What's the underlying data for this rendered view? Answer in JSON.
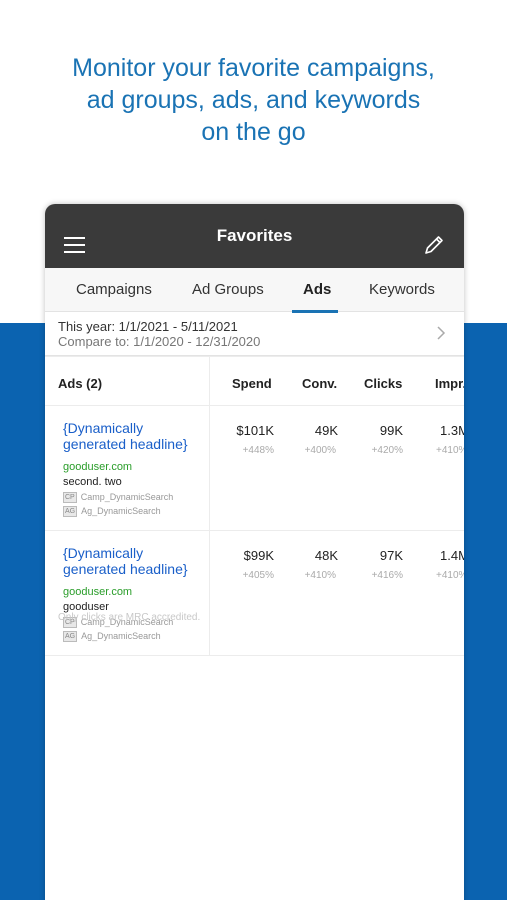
{
  "headline": {
    "line1": "Monitor your favorite campaigns,",
    "line2": "ad groups, ads, and keywords",
    "line3": "on the go"
  },
  "app": {
    "title": "Favorites",
    "tabs": [
      "Campaigns",
      "Ad Groups",
      "Ads",
      "Keywords"
    ],
    "active_tab": "Ads",
    "date_range": "This year: 1/1/2021 - 5/11/2021",
    "compare_range": "Compare to: 1/1/2020 -  12/31/2020"
  },
  "table": {
    "name_header": "Ads (2)",
    "columns": [
      "Spend",
      "Conv.",
      "Clicks",
      "Impr."
    ],
    "rows": [
      {
        "headline": "{Dynamically generated headline}",
        "url": "gooduser.com",
        "description": "second. two",
        "campaign_tag": "CP",
        "campaign": "Camp_DynamicSearch",
        "adgroup_tag": "AG",
        "adgroup": "Ag_DynamicSearch",
        "values": [
          "$101K",
          "49K",
          "99K",
          "1.3M"
        ],
        "changes": [
          "+448%",
          "+400%",
          "+420%",
          "+410%"
        ]
      },
      {
        "headline": "{Dynamically generated headline}",
        "url": "gooduser.com",
        "description": "gooduser",
        "campaign_tag": "CP",
        "campaign": "Camp_DynamicSearch",
        "adgroup_tag": "AG",
        "adgroup": "Ag_DynamicSearch",
        "values": [
          "$99K",
          "48K",
          "97K",
          "1.4M"
        ],
        "changes": [
          "+405%",
          "+410%",
          "+416%",
          "+410%"
        ]
      }
    ],
    "footnote": "Only clicks are MRC accredited."
  },
  "colors": {
    "accent": "#1a73b4",
    "band": "#0b63b0",
    "titlebar": "#3a3a3a",
    "link": "#1a5fc9",
    "url": "#2a9d2a"
  },
  "icons": {
    "menu": "hamburger-menu-icon",
    "edit": "pencil-icon",
    "chevron": "chevron-right-icon"
  }
}
